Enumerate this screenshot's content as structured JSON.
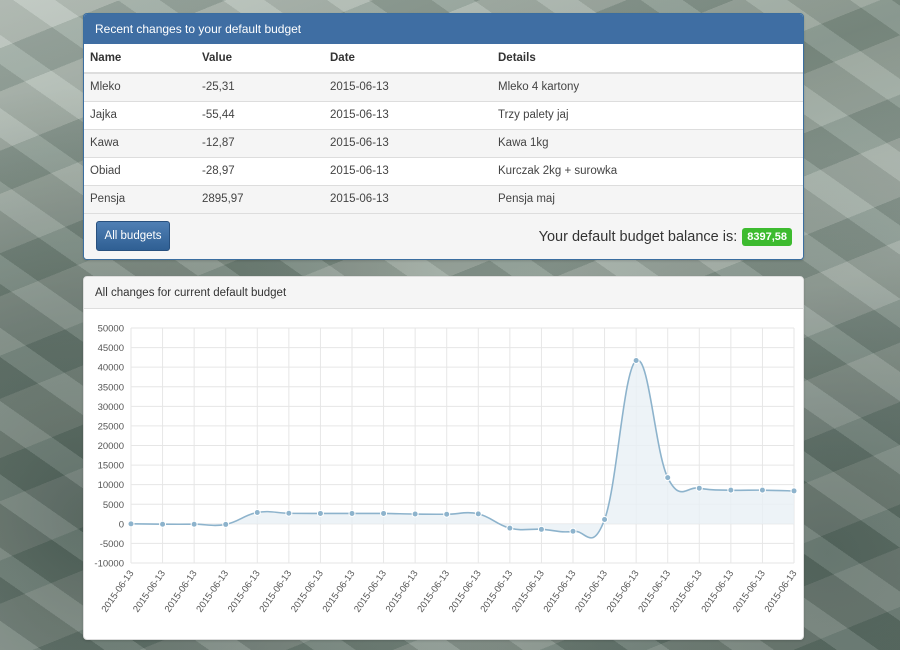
{
  "recent": {
    "title": "Recent changes to your default budget",
    "columns": [
      "Name",
      "Value",
      "Date",
      "Details"
    ],
    "rows": [
      {
        "name": "Mleko",
        "value": "-25,31",
        "date": "2015-06-13",
        "details": "Mleko 4 kartony"
      },
      {
        "name": "Jajka",
        "value": "-55,44",
        "date": "2015-06-13",
        "details": "Trzy palety jaj"
      },
      {
        "name": "Kawa",
        "value": "-12,87",
        "date": "2015-06-13",
        "details": "Kawa 1kg"
      },
      {
        "name": "Obiad",
        "value": "-28,97",
        "date": "2015-06-13",
        "details": "Kurczak 2kg + surowka"
      },
      {
        "name": "Pensja",
        "value": "2895,97",
        "date": "2015-06-13",
        "details": "Pensja maj"
      }
    ],
    "button_label": "All budgets",
    "balance_label": "Your default budget balance is:",
    "balance_value": "8397,58"
  },
  "colors": {
    "header_blue": "#3f6ea3",
    "button_blue": "#3a6a9f",
    "balance_green": "#3dbb2f",
    "line": "#8db3cc",
    "fill": "#e8f0f5"
  },
  "chart_section": {
    "title": "All changes for current default budget"
  },
  "chart_data": {
    "type": "area",
    "x": [
      "2015-06-13",
      "2015-06-13",
      "2015-06-13",
      "2015-06-13",
      "2015-06-13",
      "2015-06-13",
      "2015-06-13",
      "2015-06-13",
      "2015-06-13",
      "2015-06-13",
      "2015-06-13",
      "2015-06-13",
      "2015-06-13",
      "2015-06-13",
      "2015-06-13",
      "2015-06-13",
      "2015-06-13",
      "2015-06-13",
      "2015-06-13",
      "2015-06-13",
      "2015-06-13",
      "2015-06-13"
    ],
    "series": [
      {
        "values": [
          0,
          -100,
          -100,
          -150,
          2900,
          2700,
          2650,
          2650,
          2650,
          2500,
          2450,
          2550,
          -1100,
          -1400,
          -1900,
          1100,
          41700,
          11800,
          9100,
          8600,
          8600,
          8400
        ]
      }
    ],
    "ylim": [
      -10000,
      50000
    ],
    "yticks": [
      -10000,
      -5000,
      0,
      5000,
      10000,
      15000,
      20000,
      25000,
      30000,
      35000,
      40000,
      45000,
      50000
    ],
    "grid": true
  }
}
